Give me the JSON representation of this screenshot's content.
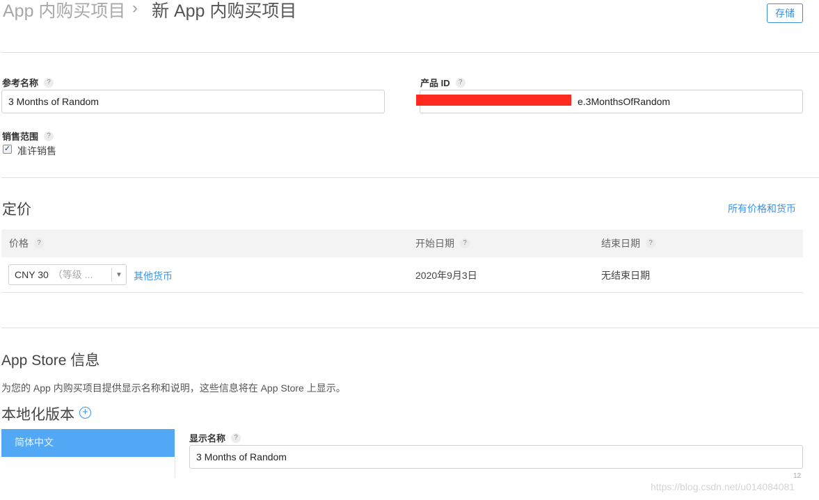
{
  "header": {
    "breadcrumb_root": "App 内购买项目",
    "breadcrumb_separator": "›",
    "breadcrumb_current": "新 App 内购买项目",
    "save_label": "存储"
  },
  "details": {
    "reference_name_label": "参考名称",
    "reference_name_value": "3 Months of Random",
    "product_id_label": "产品 ID",
    "product_id_value": "e.3MonthsOfRandom",
    "sales_scope_label": "销售范围",
    "allow_sales_label": "准许销售",
    "allow_sales_checked": true,
    "help_glyph": "?"
  },
  "pricing": {
    "title": "定价",
    "all_prices_link": "所有价格和货币",
    "columns": [
      "价格",
      "开始日期",
      "结束日期"
    ],
    "price_select_value": "CNY 30",
    "price_select_tier": "（等级 ...",
    "other_currency_link": "其他货币",
    "start_date": "2020年9月3日",
    "end_date": "无结束日期"
  },
  "appstore": {
    "title": "App Store 信息",
    "description": "为您的 App 内购买项目提供显示名称和说明，这些信息将在 App Store 上显示。",
    "localizations_title": "本地化版本",
    "localization_items": [
      "简体中文"
    ],
    "display_name_label": "显示名称",
    "display_name_value": "3 Months of Random",
    "char_counter": "12"
  },
  "watermark": "https://blog.csdn.net/u014084081",
  "colors": {
    "accent": "#3a93e6",
    "selected_item": "#52a8f5",
    "redaction": "#ff2a1f"
  }
}
